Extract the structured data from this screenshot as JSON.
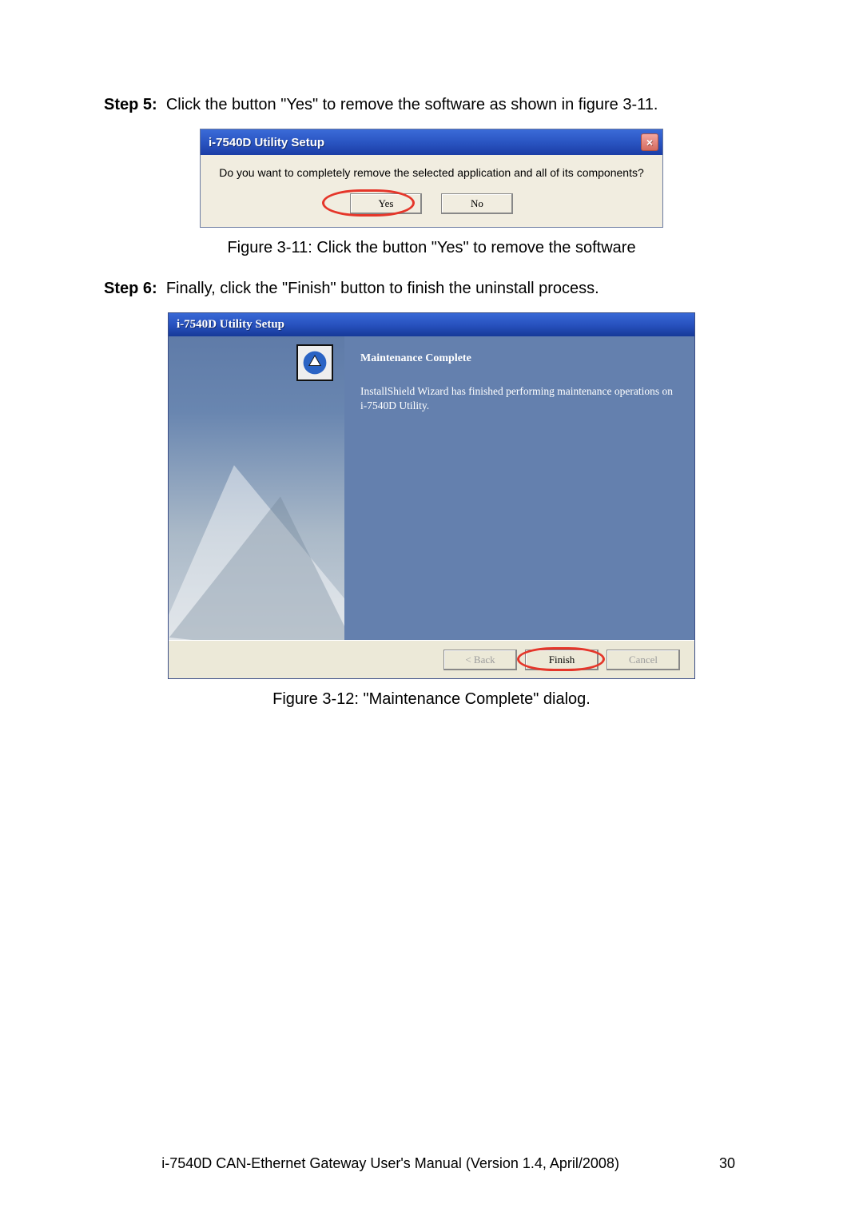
{
  "step5": {
    "label": "Step 5:",
    "text": "Click the button \"Yes\" to remove the software as shown in figure 3-11."
  },
  "dialog1": {
    "title": "i-7540D Utility Setup",
    "close": "×",
    "message": "Do you want to completely remove the selected application and all of its components?",
    "yes": "Yes",
    "no": "No"
  },
  "caption1": "Figure 3-11: Click the button \"Yes\" to remove the software",
  "step6": {
    "label": "Step 6:",
    "text": "Finally, click the \"Finish\" button to finish the uninstall process."
  },
  "dialog2": {
    "title": "i-7540D Utility Setup",
    "heading": "Maintenance Complete",
    "body": "InstallShield Wizard has finished performing maintenance operations on i-7540D Utility.",
    "back": "< Back",
    "finish": "Finish",
    "cancel": "Cancel"
  },
  "caption2": "Figure 3-12: \"Maintenance Complete\" dialog.",
  "footer": {
    "text": "i-7540D CAN-Ethernet Gateway User's Manual (Version 1.4, April/2008)",
    "page": "30"
  }
}
